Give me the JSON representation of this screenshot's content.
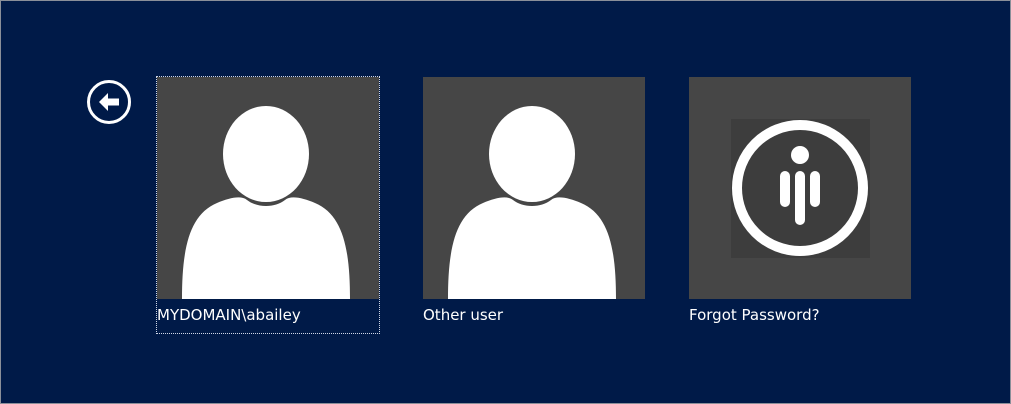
{
  "screen": {
    "background": "#001a48",
    "back_icon": "arrow-left-circle-icon"
  },
  "tiles": [
    {
      "label": "MYDOMAIN\\abailey",
      "icon": "user-avatar-icon",
      "selected": true
    },
    {
      "label": "Other user",
      "icon": "user-avatar-icon",
      "selected": false
    },
    {
      "label": "Forgot Password?",
      "icon": "password-reset-logo-icon",
      "selected": false
    }
  ],
  "colors": {
    "tile_bg": "#464646",
    "icon_fg": "#ffffff",
    "logo_inner_bg": "#3d3d3d"
  }
}
